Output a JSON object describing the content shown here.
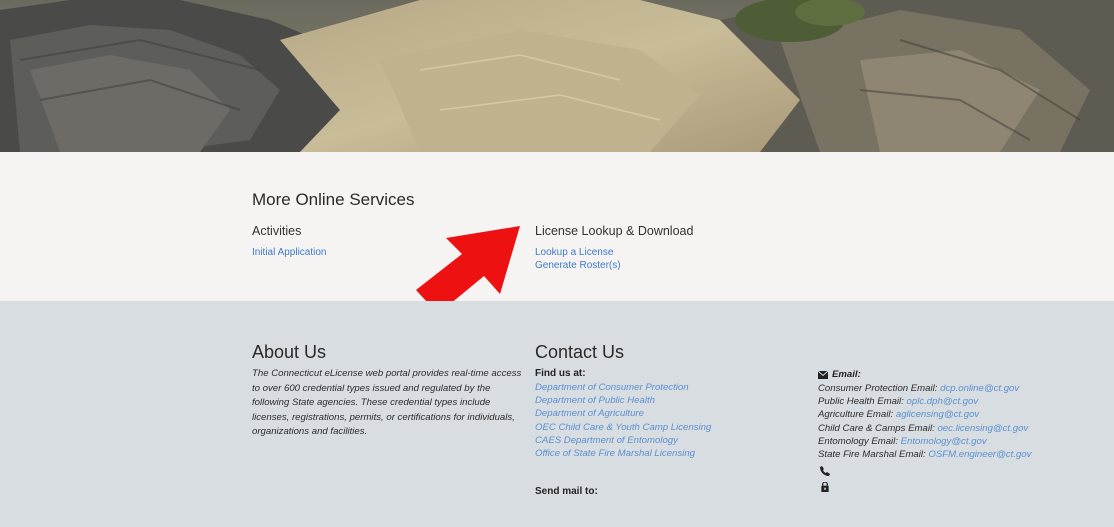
{
  "services": {
    "title": "More Online Services",
    "activities_heading": "Activities",
    "activities_links": [
      "Initial Application"
    ],
    "lookup_heading": "License Lookup & Download",
    "lookup_links": [
      "Lookup a License",
      "Generate Roster(s)"
    ]
  },
  "about": {
    "title": "About Us",
    "text": "The Connecticut eLicense web portal provides real-time access to over 600 credential types issued and regulated by the following State agencies. These credential types include licenses, registrations, permits, or certifications for individuals, organizations and facilities."
  },
  "contact": {
    "title": "Contact Us",
    "find_us_label": "Find us at:",
    "agencies": [
      "Department of Consumer Protection",
      "Department of Public Health",
      "Department of Agriculture",
      "OEC Child Care & Youth Camp Licensing",
      "CAES Department of Entomology",
      "Office of State Fire Marshal Licensing"
    ],
    "send_mail_label": "Send mail to:",
    "email_label": "Email:",
    "emails": [
      {
        "label": "Consumer Protection Email:",
        "address": "dcp.online@ct.gov"
      },
      {
        "label": "Public Health Email:",
        "address": "oplc.dph@ct.gov"
      },
      {
        "label": "Agriculture Email:",
        "address": "aglicensing@ct.gov"
      },
      {
        "label": "Child Care & Camps Email:",
        "address": "oec.licensing@ct.gov"
      },
      {
        "label": "Entomology Email:",
        "address": "Entomology@ct.gov"
      },
      {
        "label": "State Fire Marshal Email:",
        "address": "OSFM.engineer@ct.gov"
      }
    ]
  },
  "colors": {
    "link": "#3d79c9",
    "services_bg": "#f6f4f2",
    "footer_bg": "#d8dde1",
    "arrow": "#ee1111"
  },
  "icons": {
    "email": "envelope-icon",
    "phone": "phone-icon",
    "mail": "mailbox-icon",
    "annotation": "red-arrow-icon"
  }
}
